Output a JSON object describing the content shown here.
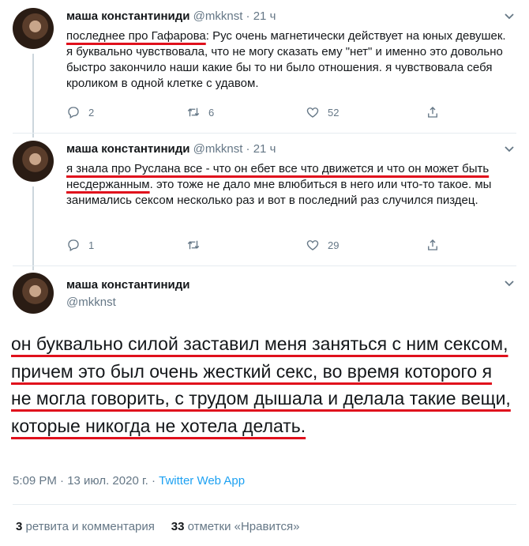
{
  "tweets": [
    {
      "name": "маша константиниди",
      "handle": "@mkknst",
      "dot": "·",
      "time": "21 ч",
      "text_highlight": "последнее про Гафарова",
      "text_rest": ": Рус очень магнетически действует на юных девушек. я буквально чувствовала, что не могу сказать ему \"нет\" и именно это довольно быстро закончило наши какие бы то ни было отношения. я чувствовала себя кроликом в одной клетке с удавом.",
      "replies": "2",
      "retweets": "6",
      "likes": "52"
    },
    {
      "name": "маша константиниди",
      "handle": "@mkknst",
      "dot": "·",
      "time": "21 ч",
      "text_highlight": "я знала про Руслана все - что он ебет все что движется и что он может быть несдержанным",
      "text_rest": ". это тоже не дало мне влюбиться в него или что-то такое. мы занимались сексом несколько раз и вот в последний раз случился пиздец.",
      "replies": "1",
      "retweets": "",
      "likes": "29"
    }
  ],
  "main_tweet": {
    "name": "маша константиниди",
    "handle": "@mkknst",
    "text": "он буквально силой заставил меня заняться с ним сексом, причем это был очень жесткий секс, во время которого я не могла говорить, с трудом дышала и делала такие вещи, которые никогда не хотела делать.",
    "time": "5:09 PM · 13 июл. 2020 г. · ",
    "source": "Twitter Web App",
    "retweets_count": "3",
    "retweets_label": "ретвита и комментария",
    "likes_count": "33",
    "likes_label": "отметки «Нравится»"
  },
  "icons": [
    "reply-icon",
    "retweet-icon",
    "like-icon",
    "share-icon",
    "chevron-down-icon"
  ],
  "colors": {
    "text": "#14171a",
    "secondary": "#657786",
    "link": "#1da1f2",
    "underline": "#e0101c",
    "divider": "#e6ecf0"
  }
}
